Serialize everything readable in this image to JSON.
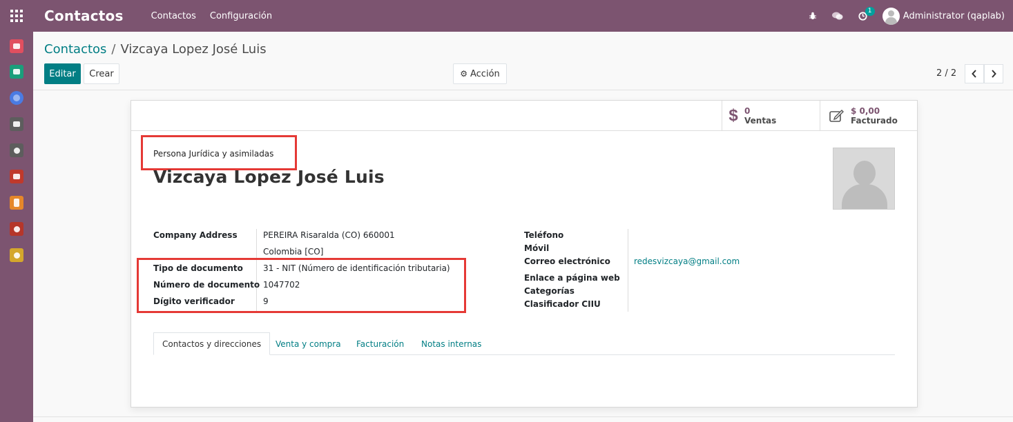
{
  "topbar": {
    "app_title": "Contactos",
    "menu": [
      "Contactos",
      "Configuración"
    ],
    "activity_count": "1",
    "user": "Administrator (qaplab)"
  },
  "sidebar": {
    "apps": [
      {
        "icon": "discuss-icon",
        "color": "#e04f5f"
      },
      {
        "icon": "contacts-icon",
        "color": "#1a9e7b"
      },
      {
        "icon": "website-icon",
        "color": "#4a7be3"
      },
      {
        "icon": "inventory-icon",
        "color": "#5d5d5d"
      },
      {
        "icon": "link-icon",
        "color": "#5d5d5d"
      },
      {
        "icon": "sales-icon",
        "color": "#c0392b"
      },
      {
        "icon": "invoicing-icon",
        "color": "#e5872a"
      },
      {
        "icon": "apps-icon",
        "color": "#b5362a"
      },
      {
        "icon": "settings-icon",
        "color": "#d4a72c"
      }
    ]
  },
  "breadcrumb": {
    "parent": "Contactos",
    "separator": "/",
    "current": "Vizcaya Lopez José Luis"
  },
  "buttons": {
    "edit": "Editar",
    "create": "Crear",
    "action": "Acción"
  },
  "pager": {
    "value": "2 / 2"
  },
  "stats": {
    "sales": {
      "value": "0",
      "label": "Ventas"
    },
    "invoiced": {
      "value": "$ 0,00",
      "label": "Facturado"
    }
  },
  "form": {
    "person_type": "Persona Jurídica y asimiladas",
    "name": "Vizcaya Lopez José Luis",
    "left_fields": {
      "company_address_label": "Company Address",
      "address_line1": "PEREIRA  Risaralda (CO)  660001",
      "address_line2": "Colombia [CO]",
      "doc_type_label": "Tipo de documento",
      "doc_type_value": "31 - NIT (Número de identificación tributaria)",
      "doc_number_label": "Número de documento",
      "doc_number_value": "1047702",
      "check_digit_label": "Dígito verificador",
      "check_digit_value": "9"
    },
    "right_fields": {
      "phone_label": "Teléfono",
      "mobile_label": "Móvil",
      "email_label": "Correo electrónico",
      "email_value": "redesvizcaya@gmail.com",
      "website_label": "Enlace a página web",
      "categories_label": "Categorías",
      "ciiu_label": "Clasificador CIIU"
    },
    "tabs": [
      "Contactos y direcciones",
      "Venta y compra",
      "Facturación",
      "Notas internas"
    ]
  },
  "colors": {
    "brand": "#7c5470",
    "accent": "#017e84",
    "highlight": "#e53935"
  }
}
